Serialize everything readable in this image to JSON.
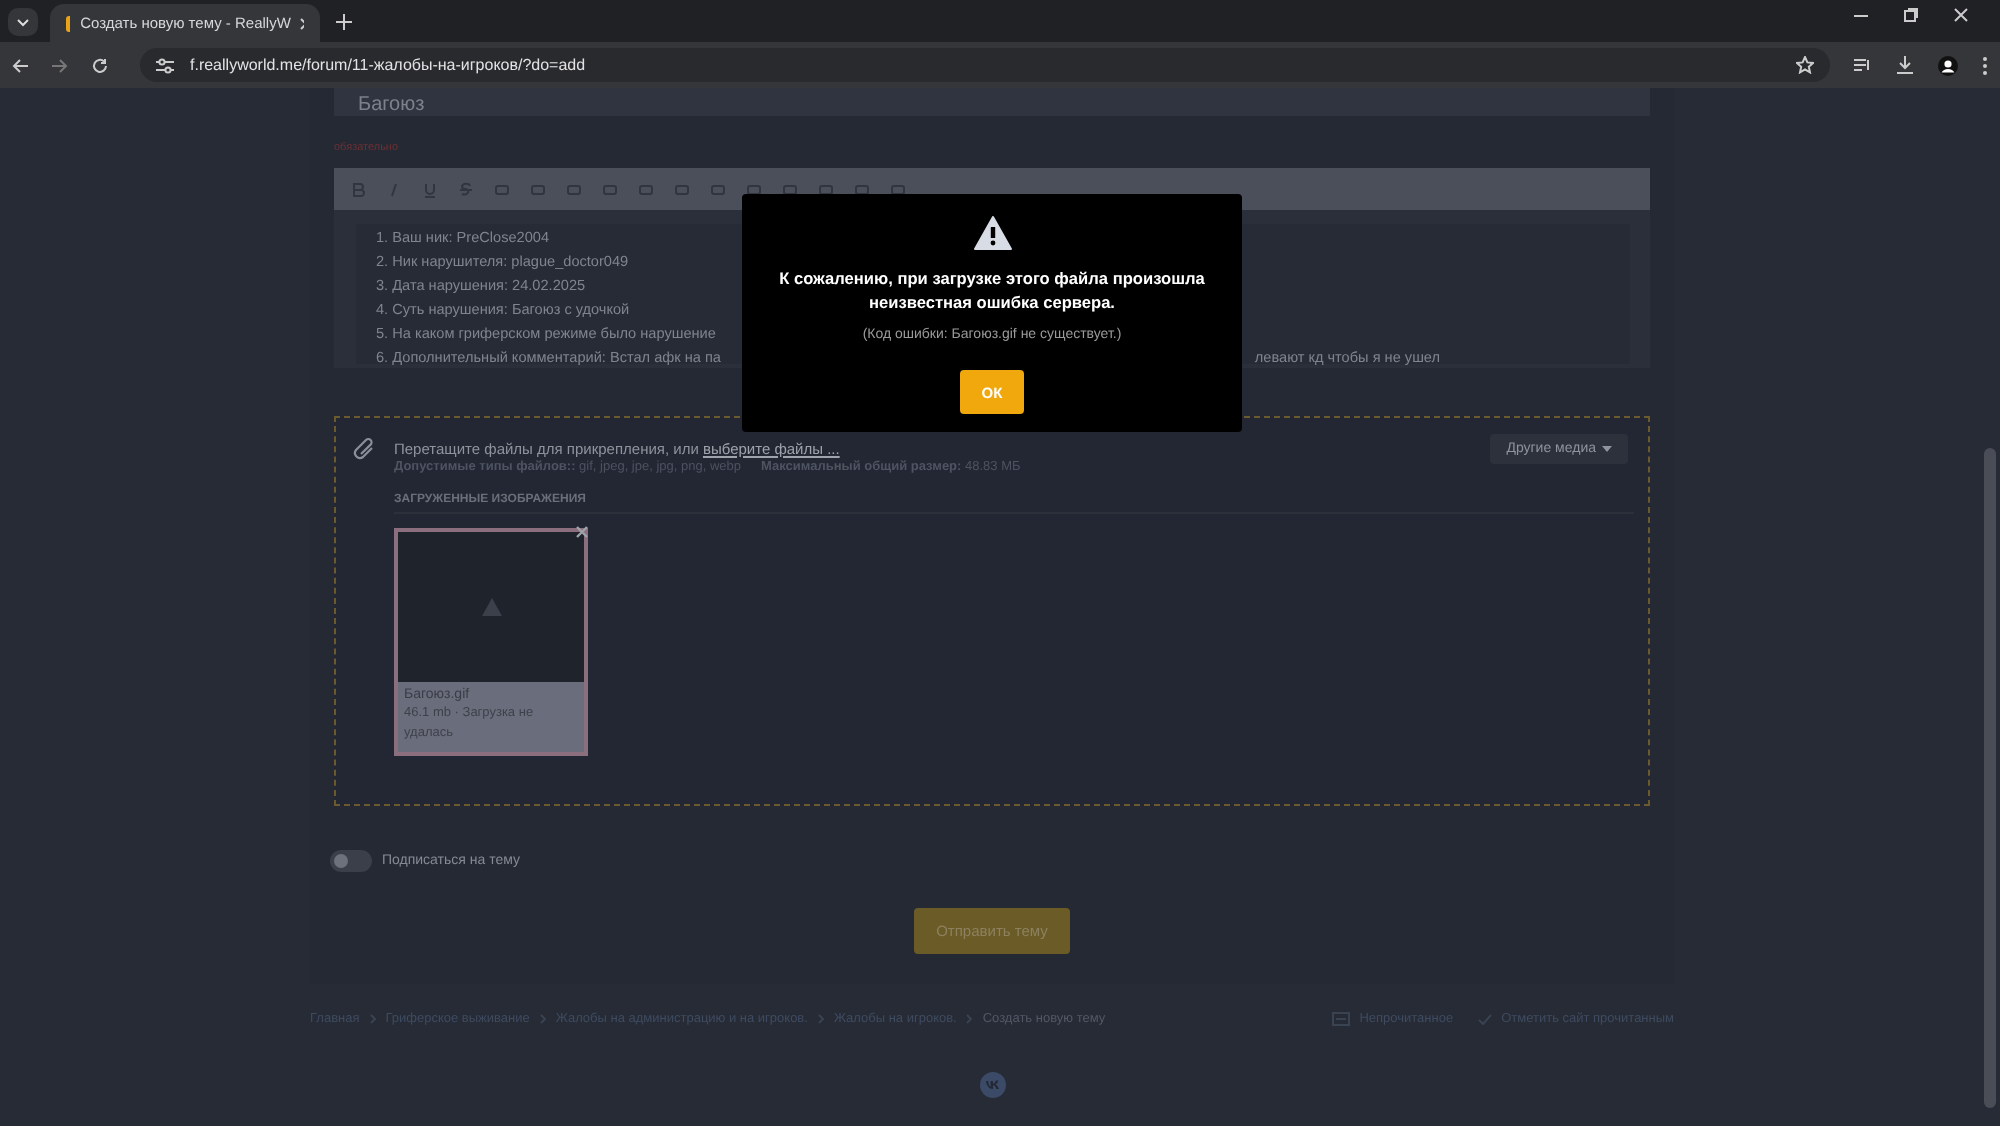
{
  "browser": {
    "tab_title": "Создать новую тему - ReallyW",
    "url": "f.reallyworld.me/forum/11-жалобы-на-игроков/?do=add"
  },
  "form": {
    "title_value": "Багоюз",
    "required_label": "обязательно",
    "editor_lines": [
      {
        "segments": [
          "1. Ваш ник: PreClose2004"
        ]
      },
      {
        "segments": [
          "2. Ник нарушителя: plague_doctor049"
        ]
      },
      {
        "segments": [
          "3. Дата нарушения: 24.02.2025"
        ]
      },
      {
        "segments": [
          "4. Суть нарушения: Багоюз с удочкой"
        ]
      },
      {
        "segments": [
          "5. На каком гриферском режиме было нарушение"
        ]
      },
      {
        "segments": [
          "6. Дополнительный комментарий: Встал афк на па",
          "левают кд чтобы я не ушел"
        ]
      }
    ]
  },
  "upload": {
    "prompt": "Перетащите файлы для прикрепления, или",
    "link": "выберите файлы ...",
    "other_media": "Другие медиа",
    "allowed_label": "Допустимые типы файлов::",
    "allowed_value": "gif, jpeg, jpe, jpg, png, webp",
    "max_label": "Максимальный общий размер:",
    "max_value": "48.83 МБ",
    "section": "ЗАГРУЖЕННЫЕ ИЗОБРАЖЕНИЯ",
    "files": [
      {
        "name": "Багоюз.gif",
        "status": "46.1 mb · Загрузка не удалась",
        "failed": true
      }
    ]
  },
  "subscribe": {
    "label": "Подписаться на тему",
    "on": false
  },
  "submit": "Отправить тему",
  "breadcrumbs": [
    {
      "label": "Главная",
      "current": false
    },
    {
      "label": "Гриферское выживание",
      "current": false
    },
    {
      "label": "Жалобы на администрацию и на игроков.",
      "current": false
    },
    {
      "label": "Жалобы на игроков.",
      "current": false
    },
    {
      "label": "Создать новую тему",
      "current": true
    }
  ],
  "footer_links": [
    {
      "kind": "unread",
      "label": "Непрочитанное"
    },
    {
      "kind": "mark-read",
      "label": "Отметить сайт прочитанным"
    }
  ],
  "modal": {
    "message": "К сожалению, при загрузке этого файла произошла неизвестная ошибка сервера.",
    "detail": "(Код ошибки: Багоюз.gif не существует.)",
    "button": "ОК"
  }
}
